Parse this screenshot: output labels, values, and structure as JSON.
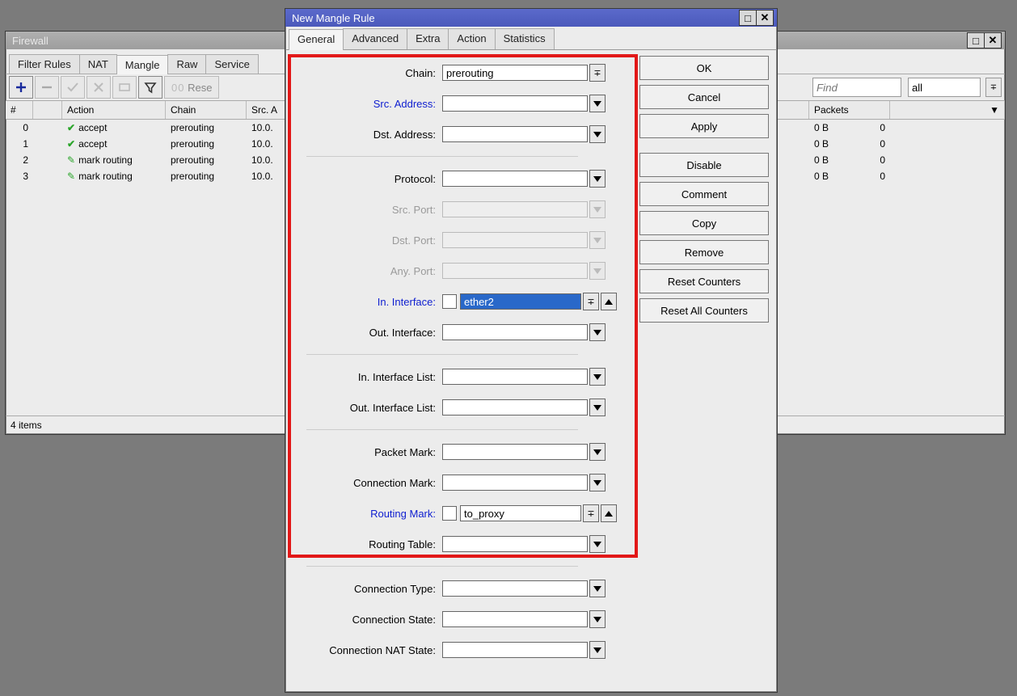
{
  "bg": {
    "title": "Firewall",
    "tabs": [
      "Filter Rules",
      "NAT",
      "Mangle",
      "Raw",
      "Service"
    ],
    "activeTab": "Mangle",
    "resetBtn": "Rese",
    "find_placeholder": "Find",
    "filter_all": "all",
    "cols": {
      "num": "#",
      "action": "Action",
      "chain": "Chain",
      "src": "Src. A",
      "packets": "Packets"
    },
    "rows": [
      {
        "n": "0",
        "act": "accept",
        "icon": "check",
        "chain": "prerouting",
        "src": "10.0.",
        "bytes": "0 B",
        "pk": "0"
      },
      {
        "n": "1",
        "act": "accept",
        "icon": "check",
        "chain": "prerouting",
        "src": "10.0.",
        "bytes": "0 B",
        "pk": "0"
      },
      {
        "n": "2",
        "act": "mark routing",
        "icon": "pencil",
        "chain": "prerouting",
        "src": "10.0.",
        "bytes": "0 B",
        "pk": "0"
      },
      {
        "n": "3",
        "act": "mark routing",
        "icon": "pencil",
        "chain": "prerouting",
        "src": "10.0.",
        "bytes": "0 B",
        "pk": "0"
      }
    ],
    "status": "4 items"
  },
  "modal": {
    "title": "New Mangle Rule",
    "tabs": [
      "General",
      "Advanced",
      "Extra",
      "Action",
      "Statistics"
    ],
    "activeTab": "General",
    "btns": {
      "ok": "OK",
      "cancel": "Cancel",
      "apply": "Apply",
      "disable": "Disable",
      "comment": "Comment",
      "copy": "Copy",
      "remove": "Remove",
      "resetc": "Reset Counters",
      "resetall": "Reset All Counters"
    },
    "fields": {
      "chain": {
        "label": "Chain:",
        "value": "prerouting"
      },
      "srcaddr": {
        "label": "Src. Address:"
      },
      "dstaddr": {
        "label": "Dst. Address:"
      },
      "proto": {
        "label": "Protocol:"
      },
      "srcport": {
        "label": "Src. Port:"
      },
      "dstport": {
        "label": "Dst. Port:"
      },
      "anyport": {
        "label": "Any. Port:"
      },
      "iniface": {
        "label": "In. Interface:",
        "value": "ether2"
      },
      "outiface": {
        "label": "Out. Interface:"
      },
      "inlist": {
        "label": "In. Interface List:"
      },
      "outlist": {
        "label": "Out. Interface List:"
      },
      "pmark": {
        "label": "Packet Mark:"
      },
      "cmark": {
        "label": "Connection Mark:"
      },
      "rmark": {
        "label": "Routing Mark:",
        "value": "to_proxy"
      },
      "rtable": {
        "label": "Routing Table:"
      },
      "ctype": {
        "label": "Connection Type:"
      },
      "cstate": {
        "label": "Connection State:"
      },
      "cnat": {
        "label": "Connection NAT State:"
      }
    }
  }
}
